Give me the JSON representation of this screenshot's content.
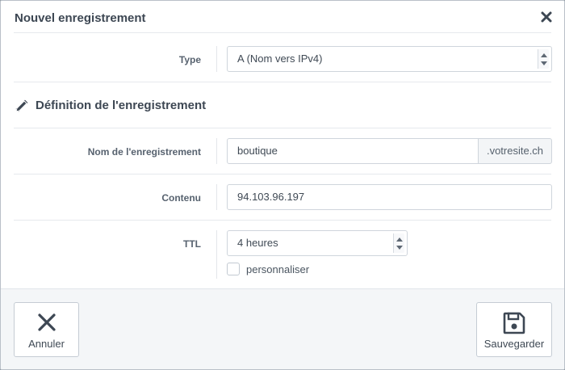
{
  "dialog": {
    "title": "Nouvel enregistrement"
  },
  "type_row": {
    "label": "Type",
    "value": "A (Nom vers IPv4)"
  },
  "section": {
    "title": "Définition de l'enregistrement",
    "icon": "pencil-ruler-icon"
  },
  "name_row": {
    "label": "Nom de l'enregistrement",
    "value": "boutique",
    "suffix": ".votresite.ch"
  },
  "content_row": {
    "label": "Contenu",
    "value": "94.103.96.197"
  },
  "ttl_row": {
    "label": "TTL",
    "value": "4 heures",
    "custom_label": "personnaliser",
    "custom_checked": false
  },
  "footer": {
    "cancel_label": "Annuler",
    "save_label": "Sauvegarder"
  },
  "colors": {
    "text": "#3c4652",
    "border": "#cfd5dc",
    "footer_bg": "#f4f6f8"
  }
}
